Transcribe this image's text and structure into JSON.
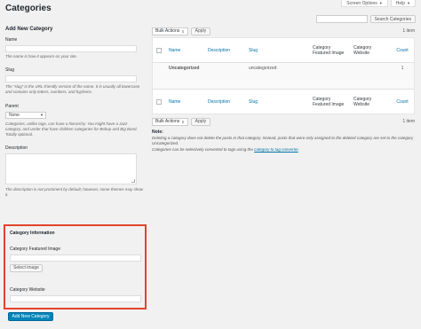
{
  "screen_tabs": {
    "screen_options": "Screen Options",
    "help": "Help"
  },
  "page_title": "Categories",
  "search": {
    "button_label": "Search Categories",
    "value": "",
    "placeholder": ""
  },
  "add_form": {
    "title": "Add New Category",
    "name_label": "Name",
    "name_help": "The name is how it appears on your site.",
    "slug_label": "Slug",
    "slug_help": "The “slug” is the URL-friendly version of the name. It is usually all lowercase and contains only letters, numbers, and hyphens.",
    "parent_label": "Parent",
    "parent_selected": "None",
    "parent_help": "Categories, unlike tags, can have a hierarchy. You might have a Jazz category, and under that have children categories for Bebop and Big Band. Totally optional.",
    "description_label": "Description",
    "description_help": "The description is not prominent by default; however, some themes may show it.",
    "category_info": {
      "heading": "Category Information",
      "featured_image_label": "Category Featured Image",
      "select_image_button": "Select image",
      "website_label": "Category Website"
    },
    "submit_button": "Add New Category"
  },
  "table": {
    "bulk_actions": "Bulk Actions",
    "apply": "Apply",
    "item_count": "1 item",
    "columns": {
      "name": "Name",
      "description": "Description",
      "slug": "Slug",
      "featured_image": "Category Featured Image",
      "website": "Category Website",
      "count": "Count"
    },
    "rows": [
      {
        "name": "Uncategorized",
        "description": "",
        "slug": "uncategorized",
        "featured_image": "",
        "website": "",
        "count": "1"
      }
    ]
  },
  "notes": {
    "title": "Note:",
    "delete_note": "Deleting a category does not delete the posts in that category. Instead, posts that were only assigned to the deleted category are set to the category Uncategorized.",
    "convert_prefix": "Categories can be selectively converted to tags using the ",
    "convert_link": "category to tag converter",
    "convert_suffix": "."
  }
}
